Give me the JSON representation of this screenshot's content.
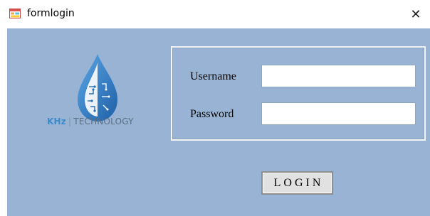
{
  "window": {
    "title": "formlogin",
    "icon": "app-form-icon",
    "close_glyph": "✕"
  },
  "logo": {
    "brand": "KHz",
    "separator": "|",
    "name": "TECHNOLOGY",
    "colors": {
      "drop": "#2f7cc4",
      "brand": "#3f8ac9",
      "name": "#5b6f83"
    }
  },
  "form": {
    "username_label": "Username",
    "username_value": "",
    "password_label": "Password",
    "password_value": "",
    "login_label": "LOGIN"
  },
  "colors": {
    "client_background": "#98b3d4",
    "button_face": "#e1e1e1"
  }
}
